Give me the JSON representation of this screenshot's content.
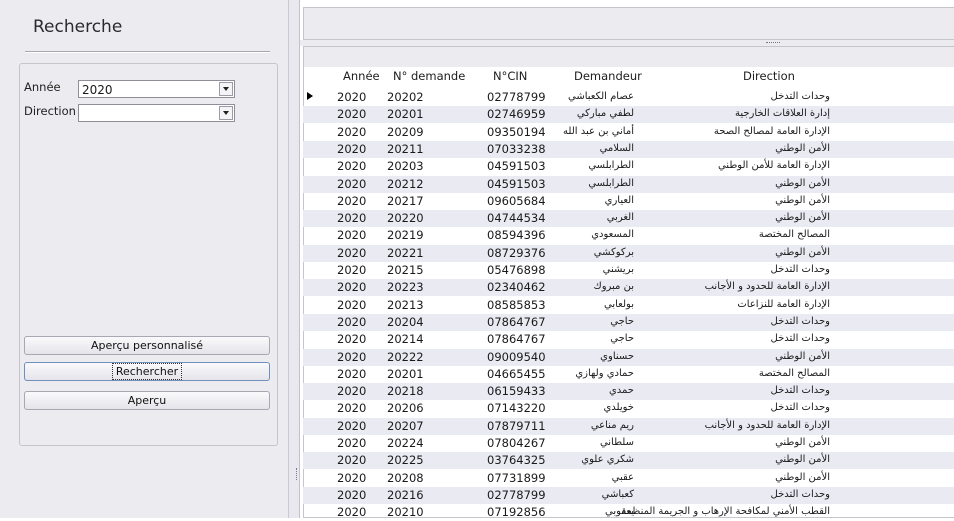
{
  "left_panel": {
    "title": "Recherche",
    "annee_label": "Année",
    "annee_value": "2020",
    "direction_label": "Direction",
    "direction_value": "",
    "btn_apercu_perso": "Aperçu personnalisé",
    "btn_rechercher": "Rechercher",
    "btn_apercu": "Aperçu"
  },
  "grid": {
    "columns": [
      "Année",
      "N° demande",
      "N°CIN",
      "Demandeur",
      "Direction"
    ],
    "rows": [
      [
        "2020",
        "20202",
        "02778799",
        "عصام الكعباشي",
        "وحدات التدخل"
      ],
      [
        "2020",
        "20201",
        "02746959",
        "لطفي مباركي",
        "إدارة العلاقات الخارجية"
      ],
      [
        "2020",
        "20209",
        "09350194",
        "أماني بن عبد الله",
        "الإدارة العامة لمصالح الصحة"
      ],
      [
        "2020",
        "20211",
        "07033238",
        "السلامي",
        "الأمن الوطني"
      ],
      [
        "2020",
        "20203",
        "04591503",
        "الطرابلسي",
        "الإدارة العامة للأمن الوطني"
      ],
      [
        "2020",
        "20212",
        "04591503",
        "الطرابلسي",
        "الأمن الوطني"
      ],
      [
        "2020",
        "20217",
        "09605684",
        "العياري",
        "الأمن الوطني"
      ],
      [
        "2020",
        "20220",
        "04744534",
        "الغربي",
        "الأمن الوطني"
      ],
      [
        "2020",
        "20219",
        "08594396",
        "المسعودي",
        "المصالح المختصة"
      ],
      [
        "2020",
        "20221",
        "08729376",
        "بركوكشي",
        "الأمن الوطني"
      ],
      [
        "2020",
        "20215",
        "05476898",
        "بريشني",
        "وحدات التدخل"
      ],
      [
        "2020",
        "20223",
        "02340462",
        "بن مبروك",
        "الإدارة العامة للحدود و الأجانب"
      ],
      [
        "2020",
        "20213",
        "08585853",
        "بولعابي",
        "الإدارة العامة للنزاعات"
      ],
      [
        "2020",
        "20204",
        "07864767",
        "حاجي",
        "وحدات التدخل"
      ],
      [
        "2020",
        "20214",
        "07864767",
        "حاجي",
        "وحدات التدخل"
      ],
      [
        "2020",
        "20222",
        "09009540",
        "حسناوي",
        "الأمن الوطني"
      ],
      [
        "2020",
        "20201",
        "04665455",
        "حمادي ولهازي",
        "المصالح المختصة"
      ],
      [
        "2020",
        "20218",
        "06159433",
        "حمدي",
        "وحدات التدخل"
      ],
      [
        "2020",
        "20206",
        "07143220",
        "خويلدي",
        "وحدات التدخل"
      ],
      [
        "2020",
        "20207",
        "07879711",
        "ريم مناعي",
        "الإدارة العامة للحدود و الأجانب"
      ],
      [
        "2020",
        "20224",
        "07804267",
        "سلطاني",
        "الأمن الوطني"
      ],
      [
        "2020",
        "20225",
        "03764325",
        "شكري علوي",
        "الأمن الوطني"
      ],
      [
        "2020",
        "20208",
        "07731899",
        "عقبي",
        "الأمن الوطني"
      ],
      [
        "2020",
        "20216",
        "02778799",
        "كعباشي",
        "وحدات التدخل"
      ],
      [
        "2020",
        "20210",
        "07192856",
        "يعقوبي",
        "القطب الأمني لمكافحة الإرهاب و الجريمة المنظمة"
      ]
    ]
  }
}
